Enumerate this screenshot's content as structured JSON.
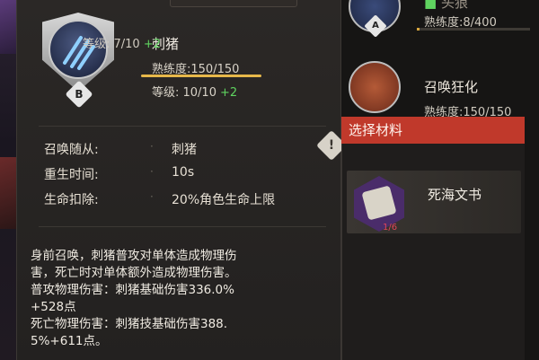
{
  "skill": {
    "name": "刺猪",
    "grade": "B",
    "proficiency_label": "熟练度:150/150",
    "proficiency_fraction": 1.0,
    "level_label": "等级: 10/10",
    "level_bonus": "+2",
    "icon": "claw-slash-icon"
  },
  "attributes": [
    {
      "key": "召唤随从:",
      "value": "刺猪"
    },
    {
      "key": "重生时间:",
      "value": "10s"
    },
    {
      "key": "生命扣除:",
      "value": "20%角色生命上限"
    }
  ],
  "description": [
    "身前召唤，刺猪普攻对单体造成物理伤",
    "害，死亡时对单体额外造成物理伤害。",
    "普攻物理伤害：刺猪基础伤害336.0%",
    "+528点",
    "死亡物理伤害：刺猪技基础伤害388.",
    "5%+611点。"
  ],
  "side_skills": [
    {
      "title_partial": "头狼",
      "proficiency_label": "熟练度:8/400",
      "proficiency_fraction": 0.02,
      "level_label": "等级: 7/10",
      "level_bonus": "+2",
      "grade": "A"
    },
    {
      "title": "召唤狂化",
      "proficiency_label": "熟练度:150/150",
      "proficiency_fraction": 1.0
    }
  ],
  "material_panel": {
    "header": "选择材料",
    "items": [
      {
        "name": "死海文书",
        "count": "1/6",
        "icon": "scroll-icon"
      }
    ]
  },
  "colors": {
    "accent_red": "#c0392b",
    "bar_gold": "#e7b84a",
    "bonus_green": "#5fd35f"
  }
}
